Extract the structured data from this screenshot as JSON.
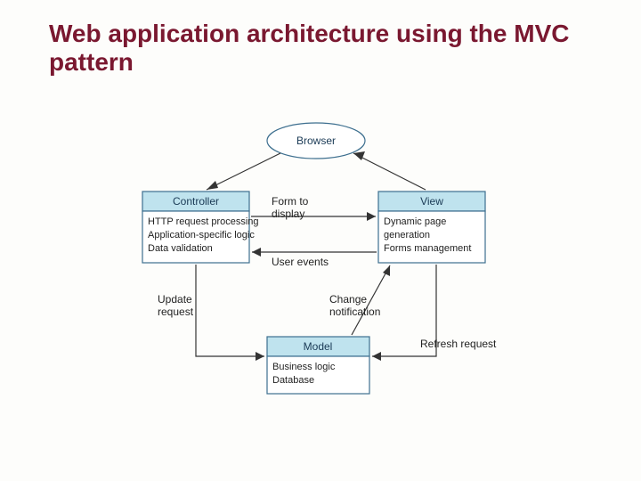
{
  "title": "Web application architecture using the MVC pattern",
  "nodes": {
    "browser": "Browser",
    "controller": {
      "header": "Controller",
      "lines": [
        "HTTP request processing",
        "Application-specific logic",
        "Data validation"
      ]
    },
    "view": {
      "header": "View",
      "lines": [
        "Dynamic page",
        "generation",
        "Forms management"
      ]
    },
    "model": {
      "header": "Model",
      "lines": [
        "Business logic",
        "Database"
      ]
    }
  },
  "edges": {
    "form_to_display": [
      "Form to",
      "display"
    ],
    "user_events": "User events",
    "update_request": [
      "Update",
      "request"
    ],
    "change_notification": [
      "Change",
      "notification"
    ],
    "refresh_request": "Refresh request"
  }
}
